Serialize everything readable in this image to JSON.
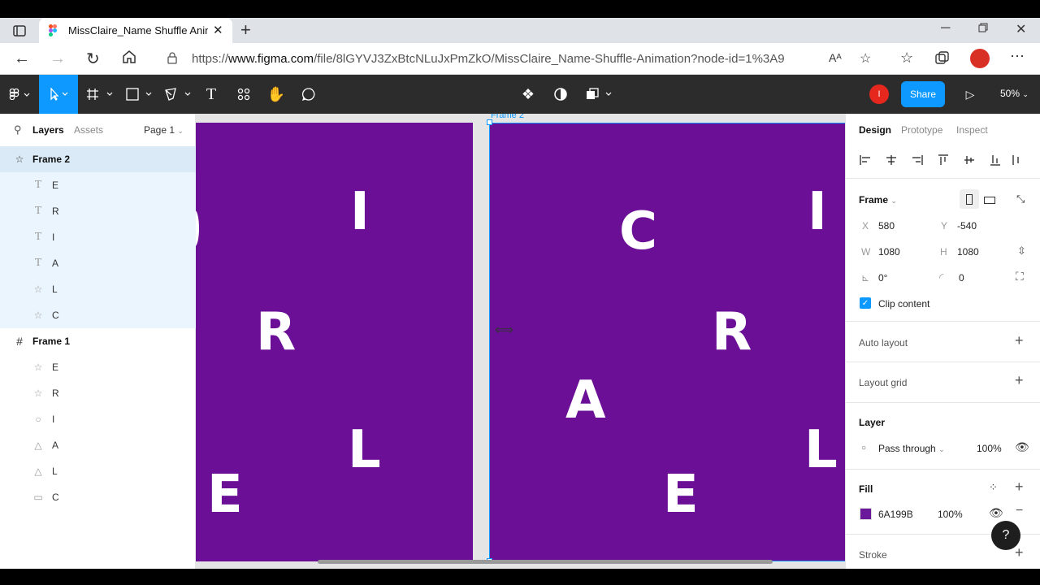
{
  "browser": {
    "tab_title": "MissClaire_Name Shuffle Animat",
    "url_prefix": "https://",
    "url_host": "www.figma.com",
    "url_path": "/file/8lGYVJ3ZxBtcNLuJxPmZkO/MissClaire_Name-Shuffle-Animation?node-id=1%3A9"
  },
  "toolbar": {
    "share_label": "Share",
    "zoom_label": "50%",
    "avatar_initial": "I"
  },
  "left_panel": {
    "tabs": {
      "layers": "Layers",
      "assets": "Assets",
      "page": "Page 1"
    },
    "frame2": {
      "name": "Frame 2",
      "children": [
        "E",
        "R",
        "I",
        "A",
        "L",
        "C"
      ]
    },
    "frame1": {
      "name": "Frame 1",
      "children": [
        "E",
        "R",
        "I",
        "A",
        "L",
        "C"
      ]
    }
  },
  "canvas": {
    "frame_label": "Frame 2",
    "frame1_letters": [
      "I",
      "R",
      "L",
      "E"
    ],
    "frame2_letters": [
      "C",
      "I",
      "R",
      "A",
      "L",
      "E"
    ],
    "fill_color": "#6a0f96"
  },
  "right_panel": {
    "tabs": {
      "design": "Design",
      "prototype": "Prototype",
      "inspect": "Inspect"
    },
    "frame": {
      "title": "Frame",
      "x_label": "X",
      "x": "580",
      "y_label": "Y",
      "y": "-540",
      "w_label": "W",
      "w": "1080",
      "h_label": "H",
      "h": "1080",
      "rotation": "0°",
      "radius": "0",
      "clip_content": "Clip content"
    },
    "auto_layout": "Auto layout",
    "layout_grid": "Layout grid",
    "layer": {
      "title": "Layer",
      "blend": "Pass through",
      "opacity": "100%"
    },
    "fill": {
      "title": "Fill",
      "hex": "6A199B",
      "opacity": "100%",
      "swatch": "#6a199b"
    },
    "stroke": "Stroke"
  }
}
